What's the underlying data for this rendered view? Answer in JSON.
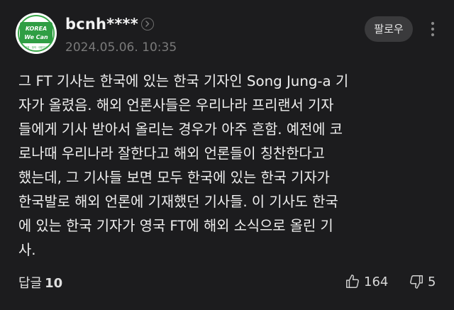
{
  "comment": {
    "author": "bcnh****",
    "date": "2024.05.06. 10:35",
    "follow_label": "팔로우",
    "avatar": {
      "line1": "KOREA",
      "line2": "We Can",
      "caption": "공정 · 정의 · 대한민국",
      "colors": {
        "ring": "#3aa84a",
        "fill": "#2f9e44",
        "text": "#ffffff"
      }
    },
    "body_lines": [
      "그 FT 기사는 한국에 있는 한국 기자인 Song Jung-a 기",
      "자가 올렸음. 해외 언론사들은 우리나라 프리랜서 기자",
      "들에게 기사 받아서 올리는 경우가 아주 흔함. 예전에 코",
      "로나때 우리나라 잘한다고 해외 언론들이 칭찬한다고",
      "했는데, 그 기사들 보면 모두 한국에 있는 한국 기자가",
      "한국발로 해외 언론에 기재했던 기사들. 이 기사도 한국",
      "에 있는 한국 기자가 영국 FT에 해외 소식으로 올린 기",
      "사."
    ],
    "footer": {
      "reply_label": "답글",
      "reply_count": "10",
      "like_count": "164",
      "dislike_count": "5"
    }
  },
  "icons": {
    "profile": "chevron-right-circle-icon",
    "more": "more-vertical-icon",
    "like": "thumbs-up-icon",
    "dislike": "thumbs-down-icon"
  },
  "theme": {
    "background": "#1c1c1e",
    "text": "#efefef",
    "muted": "#7a7a7a",
    "button_bg": "#3a3a3c"
  }
}
